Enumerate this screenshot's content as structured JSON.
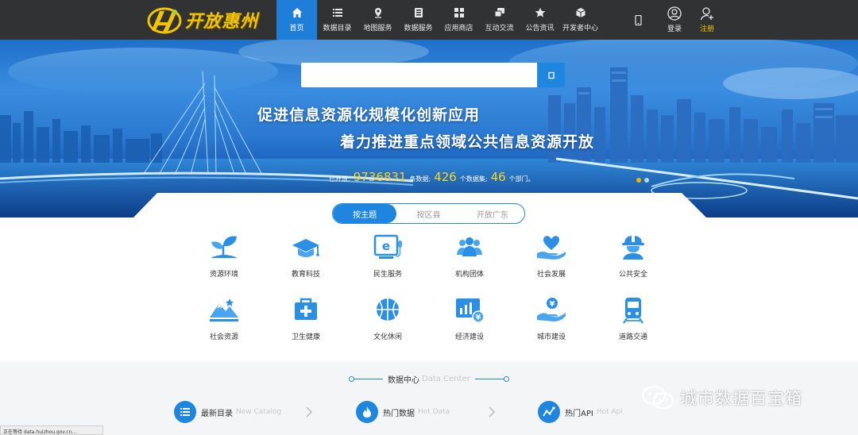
{
  "header": {
    "logo_text": "开放惠州",
    "nav": [
      {
        "label": "首页",
        "icon": "home-icon",
        "active": true
      },
      {
        "label": "数据目录",
        "icon": "list-icon"
      },
      {
        "label": "地图服务",
        "icon": "map-pin-icon"
      },
      {
        "label": "数据服务",
        "icon": "data-service-icon"
      },
      {
        "label": "应用商店",
        "icon": "apps-grid-icon"
      },
      {
        "label": "互动交流",
        "icon": "chat-icon"
      },
      {
        "label": "公告资讯",
        "icon": "star-icon"
      },
      {
        "label": "开发者中心",
        "icon": "cube-icon"
      }
    ],
    "login_label": "登录",
    "register_label": "注册"
  },
  "banner": {
    "search_placeholder": "",
    "slogan_line1": "促进信息资源化规模化创新应用",
    "slogan_line2": "着力推进重点领域公共信息资源开放",
    "stats": {
      "prefix": "已开放:",
      "records": "9736831",
      "records_unit": "条数据;",
      "datasets": "426",
      "datasets_unit": "个数据集;",
      "departments": "46",
      "departments_unit": "个部门。"
    },
    "carousel_active": 0
  },
  "tabs": [
    "按主题",
    "按区县",
    "开放广东"
  ],
  "topics_row1": [
    {
      "label": "资源环境",
      "icon": "sprout-icon"
    },
    {
      "label": "教育科技",
      "icon": "graduation-cap-icon"
    },
    {
      "label": "民生服务",
      "icon": "e-service-icon"
    },
    {
      "label": "机构团体",
      "icon": "people-group-icon"
    },
    {
      "label": "社会发展",
      "icon": "hand-heart-icon"
    },
    {
      "label": "公共安全",
      "icon": "safety-helmet-icon"
    }
  ],
  "topics_row2": [
    {
      "label": "社会资源",
      "icon": "mountain-icon"
    },
    {
      "label": "卫生健康",
      "icon": "medical-kit-icon"
    },
    {
      "label": "文化休闲",
      "icon": "basketball-icon"
    },
    {
      "label": "经济建设",
      "icon": "economy-chart-icon"
    },
    {
      "label": "城市建设",
      "icon": "hand-coin-icon"
    },
    {
      "label": "道路交通",
      "icon": "train-icon"
    }
  ],
  "data_center": {
    "title": "数据中心",
    "title_en": "Data Center",
    "items": [
      {
        "label": "最新目录",
        "label_en": "New Catalog",
        "icon": "list-icon"
      },
      {
        "label": "热门数据",
        "label_en": "Hot Data",
        "icon": "flame-icon"
      },
      {
        "label": "热门API",
        "label_en": "Hot Api",
        "icon": "api-trend-icon"
      }
    ]
  },
  "status_text": "正在等待 data.huizhou.gov.cn...",
  "watermark": "城市数据百宝箱",
  "colors": {
    "primary": "#1f86e0",
    "nav_bg": "#303234",
    "accent_yellow": "#f5c400"
  }
}
